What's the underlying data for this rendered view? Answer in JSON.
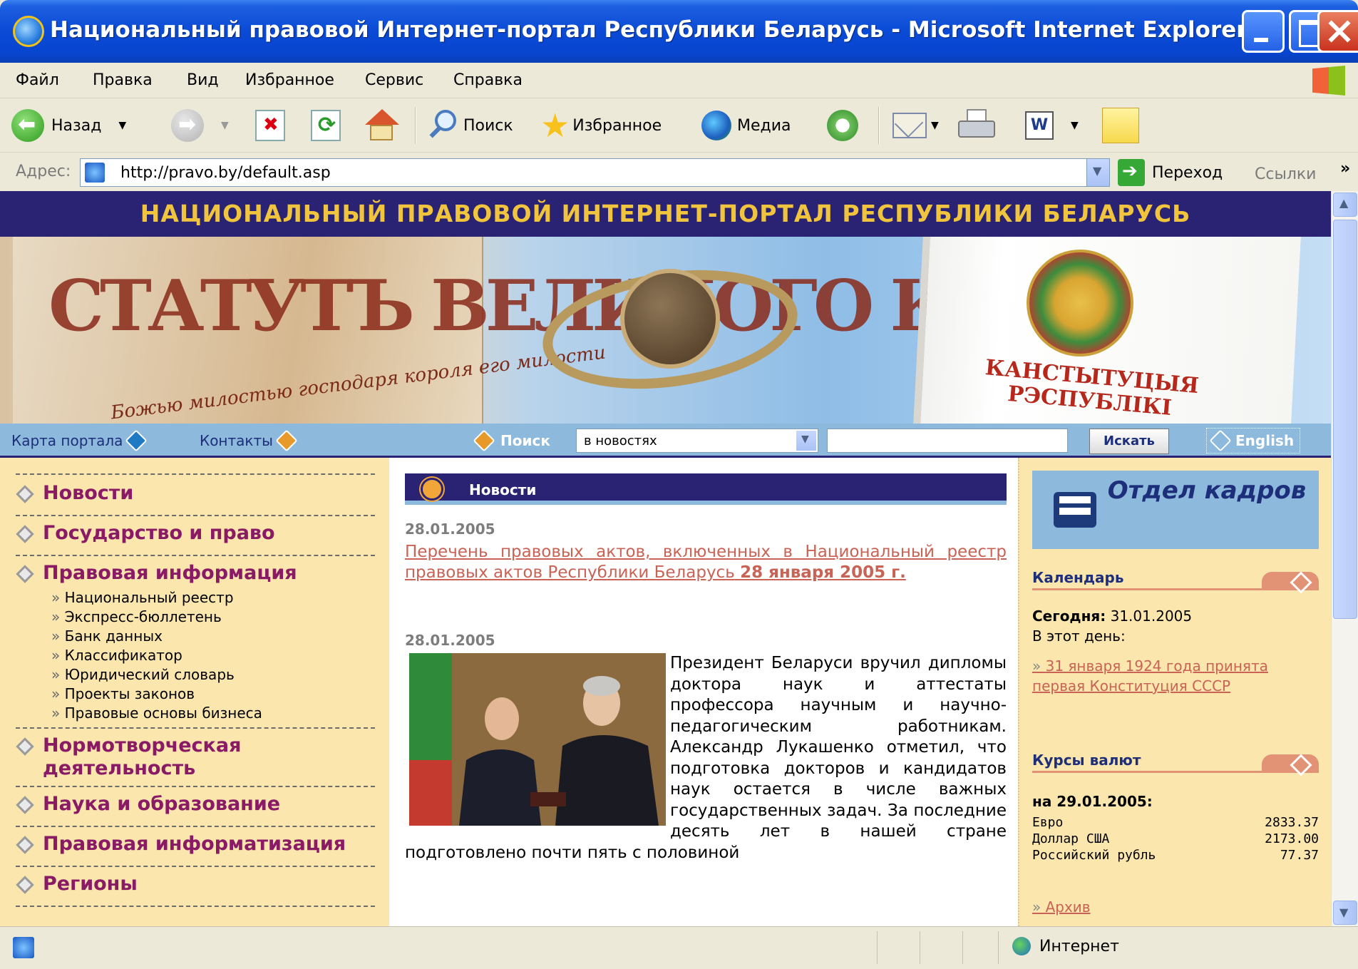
{
  "window": {
    "title": "Национальный правовой Интернет-портал Республики Беларусь - Microsoft Internet Explorer"
  },
  "menu": [
    "Файл",
    "Правка",
    "Вид",
    "Избранное",
    "Сервис",
    "Справка"
  ],
  "toolbar": {
    "back": "Назад",
    "search": "Поиск",
    "favorites": "Избранное",
    "media": "Медиа"
  },
  "address": {
    "label": "Адрес:",
    "url": "http://pravo.by/default.asp",
    "go": "Переход",
    "links": "Ссылки"
  },
  "status": {
    "zone": "Интернет"
  },
  "page": {
    "header": "НАЦИОНАЛЬНЫЙ ПРАВОВОЙ ИНТЕРНЕТ-ПОРТАЛ РЕСПУБЛИКИ БЕЛАРУСЬ",
    "banner_book_title": "КАНСТЫТУЦЫЯ РЭСПУБЛІКІ",
    "nav": {
      "map": "Карта портала",
      "contacts": "Контакты",
      "search_label": "Поиск",
      "search_scope": "в новостях",
      "search_button": "Искать",
      "english": "English"
    },
    "left_menu": [
      "Новости",
      "Государство и право",
      "Правовая информация",
      "Нормотворческая деятельность",
      "Наука и образование",
      "Правовая информатизация",
      "Регионы"
    ],
    "legal_info_sub": [
      "Национальный реестр",
      "Экспресс-бюллетень",
      "Банк данных",
      "Классификатор",
      "Юридический словарь",
      "Проекты законов",
      "Правовые основы бизнеса"
    ],
    "news": {
      "heading": "Новости",
      "item1": {
        "date": "28.01.2005",
        "link": "Перечень правовых актов, включенных в Национальный реестр правовых актов Республики Беларусь",
        "link_date": "28 января 2005 г."
      },
      "item2": {
        "date": "28.01.2005",
        "text": "Президент Беларуси вручил дипломы доктора наук и аттестаты профессора научным и научно-педагогическим работникам. Александр Лукашенко отметил, что подготовка докторов и кандидатов наук остается в числе важных государственных задач. За последние десять лет в нашей стране подготовлено почти пять с половиной"
      }
    },
    "right": {
      "kadry": "Отдел кадров",
      "calendar_title": "Календарь",
      "today_label": "Сегодня:",
      "today_date": "31.01.2005",
      "this_day": "В этот день:",
      "event_link": "31 января 1924 года принята первая Конституция СССР",
      "rates_title": "Курсы валют",
      "rates_date": "на 29.01.2005:",
      "rates": [
        {
          "name": "Евро",
          "value": "2833.37"
        },
        {
          "name": "Доллар США",
          "value": "2173.00"
        },
        {
          "name": "Российский рубль",
          "value": "77.37"
        }
      ],
      "archive": "Архив"
    }
  },
  "colors": {
    "header_bg": "#2a2374",
    "header_text": "#f0c43d",
    "left_menu_text": "#8b1a66",
    "nav_bg": "#8db9dc",
    "sidebar_bg": "#fbe6ad"
  }
}
